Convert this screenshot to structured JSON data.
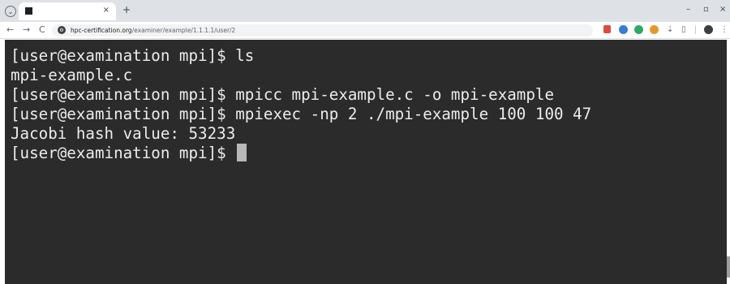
{
  "browser": {
    "tab_title": "",
    "new_tab_symbol": "+",
    "tab_close_symbol": "×",
    "window_controls": {
      "minimize": "–",
      "maximize": "▫",
      "close": "×"
    },
    "nav": {
      "back": "←",
      "forward": "→",
      "reload": "C"
    },
    "url_host": "hpc-certification.org",
    "url_path": "/examiner/example/1.1.1.1/user/2",
    "toolbar_icons": [
      "extension-red-icon",
      "extension-blue-icon",
      "extension-green-icon",
      "extension-orange-icon",
      "extension-pin-icon",
      "sidebar-icon",
      "profile-icon",
      "menu-icon"
    ],
    "colors": {
      "accent_red": "#d94c3d",
      "accent_blue": "#3a7bd5",
      "accent_green": "#2fa86b",
      "accent_orange": "#e39a2d"
    }
  },
  "terminal": {
    "background": "#2b2b2b",
    "foreground": "#ececec",
    "lines": [
      "[user@examination mpi]$ ls",
      "mpi-example.c",
      "[user@examination mpi]$ mpicc mpi-example.c -o mpi-example",
      "[user@examination mpi]$ mpiexec -np 2 ./mpi-example 100 100 47",
      "Jacobi hash value: 53233",
      "[user@examination mpi]$ "
    ]
  }
}
